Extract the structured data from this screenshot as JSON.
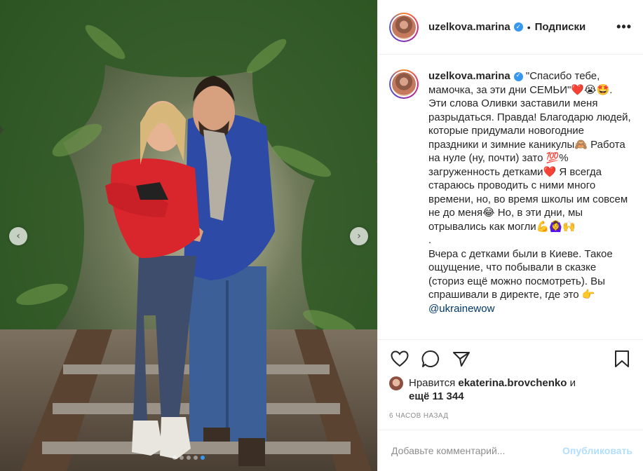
{
  "post": {
    "username": "uzelkova.marina",
    "separator": "•",
    "follow_label": "Подписки",
    "more_label": "•••",
    "verified_mark": "✓",
    "caption_part1": " \"Спасибо тебе, мамочка, за эти дни СЕМЬИ\"❤️😭🤩. Эти слова Оливки заставили меня разрыдаться. Правда! Благодарю людей, которые придумали новогодние праздники и зимние каникулы🙈 Работа на нуле (ну, почти) зато 💯% загруженность детками❤️ Я всегда стараюсь проводить с ними много времени, но, во время школы им совсем не до меня😂 Но, в эти дни, мы отрывались как могли💪🙆‍♀️🙌\n.\nВчера с детками были в Киеве. Такое ощущение, что побывали в сказке (сториз ещё можно посмотреть). Вы спрашивали в директе, где это 👉",
    "caption_mention": "@ukrainewow",
    "likes_prefix": "Нравится ",
    "likes_user": "ekaterina.brovchenko",
    "likes_and": " и",
    "likes_more": "ещё 11 344",
    "time_ago": "6 часов назад",
    "comment_placeholder": "Добавьте комментарий...",
    "publish_label": "Опубликовать",
    "carousel": {
      "total_slides": 5,
      "active_index": 4
    },
    "nav_prev": "‹",
    "nav_next": "›"
  },
  "colors": {
    "accent": "#3897f0",
    "publish_disabled": "#b2dffc",
    "heart": "#ed4956"
  },
  "icons": [
    "heart-icon",
    "comment-icon",
    "share-icon",
    "bookmark-icon",
    "verified-icon",
    "more-icon"
  ]
}
